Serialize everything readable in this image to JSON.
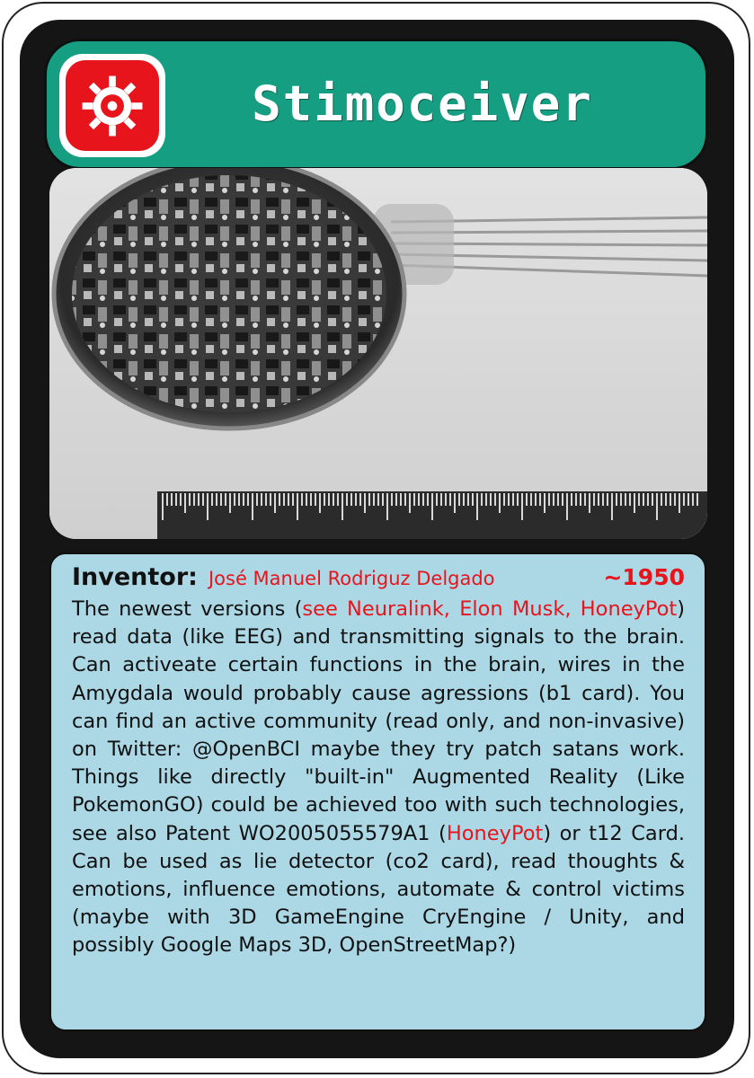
{
  "card": {
    "title": "Stimoceiver",
    "category_icon": "gear-icon",
    "colors": {
      "title_bar": "#159e82",
      "frame": "#151515",
      "icon_badge": "#e8141c",
      "text_panel": "#acd8e6",
      "highlight": "#e8141c"
    }
  },
  "info": {
    "inventor_label": "Inventor:",
    "inventor_name": "José Manuel Rodriguz Delgado",
    "year": "~1950",
    "segments": [
      "The newest versions (",
      "see Neuralink, Elon Musk, HoneyPot",
      ") read data (like EEG) and transmitting signals to the brain. Can activeate certain functions in the brain, wires in the Amygdala would probably cause agressions (b1 card). You can find an active community (read only, and non-invasive) on Twitter: @OpenBCI maybe they try patch satans work. Things like directly \"built-in\" Augmented Reality (Like PokemonGO) could be achieved too with such technologies, see also Patent WO2005055579A1 (",
      "HoneyPot",
      ") or t12 Card. Can be used as lie detector (co2 card), read thoughts & emotions, influence emotions, automate & control victims (maybe with 3D GameEngine CryEngine / Unity, and possibly Google Maps 3D, OpenStreetMap?)"
    ]
  }
}
